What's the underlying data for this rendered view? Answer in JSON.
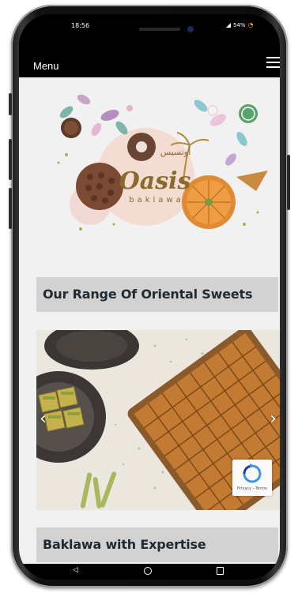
{
  "status": {
    "time": "18:56",
    "battery": "54%"
  },
  "header": {
    "menu_label": "Menu"
  },
  "hero": {
    "logo_text": "Oasis",
    "logo_sub": "baklawa",
    "logo_arabic": "أوتسيس"
  },
  "sections": [
    {
      "title": "Our Range Of Oriental Sweets"
    },
    {
      "title": "Baklawa with Expertise"
    }
  ],
  "slider": {
    "prev": "‹",
    "next": "›"
  },
  "recaptcha": {
    "terms": "Privacy - Terms"
  },
  "colors": {
    "heading_bg": "#d2d2d2",
    "heading_text": "#1f2a33",
    "logo_gold": "#8a6a2a"
  }
}
